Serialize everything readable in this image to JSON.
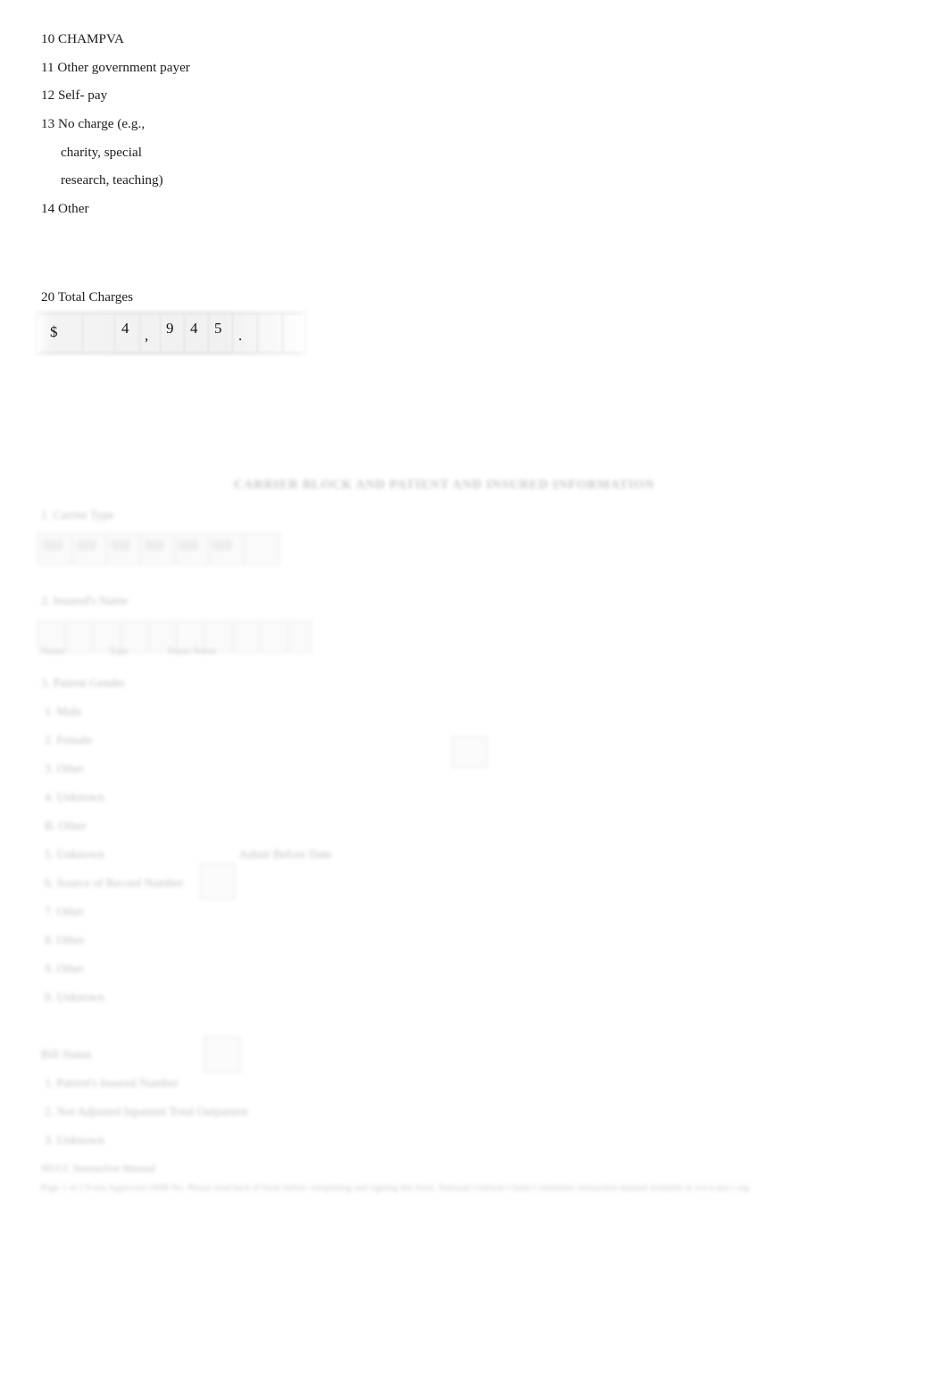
{
  "document": {
    "background_color": "#ffffff",
    "text_color": "#1c1c1c",
    "faded_text_color": "#bdbdbd"
  },
  "payer_section": {
    "items": [
      {
        "text": "10 CHAMPVA",
        "indent": false
      },
      {
        "text": "11 Other government payer",
        "indent": false
      },
      {
        "text": "12 Self- pay",
        "indent": false
      },
      {
        "text": "13 No charge (e.g.,",
        "indent": false
      },
      {
        "text": "charity, special",
        "indent": true
      },
      {
        "text": "research, teaching)",
        "indent": true
      },
      {
        "text": "14 Other",
        "indent": false
      }
    ]
  },
  "total_charges": {
    "label": "20 Total Charges",
    "dollar_sign": "$",
    "digit_1": "4",
    "comma": ",",
    "digit_2": "9",
    "digit_3": "4",
    "digit_4": "5",
    "period": "."
  },
  "faded_form": {
    "title": "CARRIER BLOCK AND PATIENT AND INSURED INFORMATION",
    "field_1_label": "1. Carrier Type",
    "field_2_label": "2. Insured's Name",
    "field_2_sub_a": "Name",
    "field_2_sub_b": "Type",
    "field_2_sub_c": "Payer Name",
    "field_3_label": "3. Patient Gender",
    "options": [
      "1. Male",
      "2. Female",
      "3. Other",
      "4. Unknown",
      "B. Other",
      "5. Unknown",
      "6. Source of Record Number",
      "7. Other",
      "8. Other",
      "9. Other",
      "0. Unknown"
    ],
    "checkbox_note": "Admit Before Date",
    "bill_section_label": "Bill Status",
    "bill_rows": [
      "1. Patient's Insured Number",
      "2. Not Adjusted Inpatient Total Outpatient",
      "3. Unknown"
    ],
    "footnote_label": "NUCC Instruction Manual",
    "footnote_text": "Page 1 of 2 Form Approved OMB No. Please read back of form before completing and signing this form. National Uniform Claim Committee instruction manual available at www.nucc.org"
  }
}
